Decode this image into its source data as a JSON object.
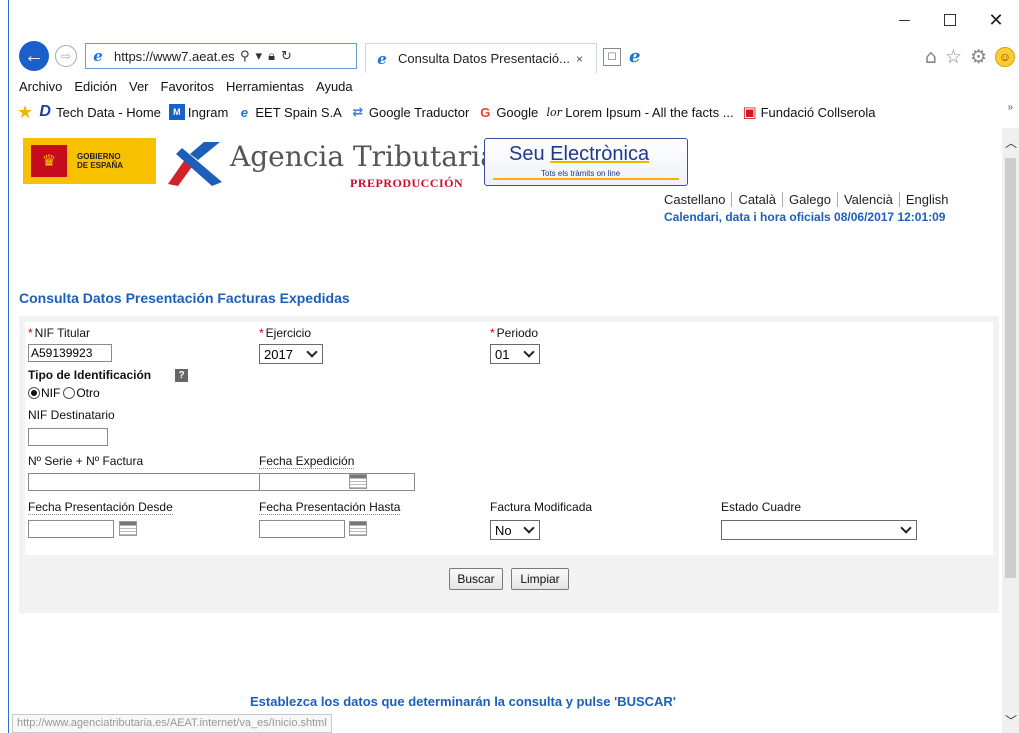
{
  "browser": {
    "url": "https://www7.aeat.es/",
    "tab_title": "Consulta Datos Presentació...",
    "tab_close": "×",
    "new_tab": "☐",
    "menu": [
      "Archivo",
      "Edición",
      "Ver",
      "Favoritos",
      "Herramientas",
      "Ayuda"
    ],
    "favorites": [
      {
        "label": "Tech Data - Home",
        "icon": "D",
        "color": "#1b3fa0"
      },
      {
        "label": "Ingram",
        "icon": "M",
        "color": "#ffffff"
      },
      {
        "label": "EET Spain S.A",
        "icon": "e",
        "color": "#1b73d9"
      },
      {
        "label": "Google Traductor",
        "icon": "↹",
        "color": "#3b7be0"
      },
      {
        "label": "Google",
        "icon": "G",
        "color": "#e8442e"
      },
      {
        "label": "Lorem Ipsum - All the facts ...",
        "icon": "lor",
        "color": "#333333"
      },
      {
        "label": "Fundació Collserola",
        "icon": "■",
        "color": "#d11a1a"
      }
    ],
    "fav_more": "»",
    "status_url": "http://www.agenciatributaria.es/AEAT.internet/va_es/Inicio.shtml"
  },
  "header": {
    "gobierno_line1": "GOBIERNO",
    "gobierno_line2": "DE ESPAÑA",
    "agency_name": "Agencia Tributaria",
    "environment": "PREPRODUCCIÓN",
    "seu_title_a": "Seu ",
    "seu_title_b": "Electrònica",
    "seu_sub": "Tots els tràmits on line",
    "languages": [
      "Castellano",
      "Català",
      "Galego",
      "Valencià",
      "English"
    ],
    "calendar": "Calendari, data i hora oficials 08/06/2017 12:01:09"
  },
  "form": {
    "title": "Consulta Datos Presentación Facturas Expedidas",
    "required_mark": "*",
    "nif_titular_label": "NIF Titular",
    "nif_titular_value": "A59139923",
    "ejercicio_label": "Ejercicio",
    "ejercicio_value": "2017",
    "periodo_label": "Periodo",
    "periodo_value": "01",
    "tipo_id_label": "Tipo de Identificación",
    "help": "?",
    "radio_nif": "NIF",
    "radio_otro": "Otro",
    "nif_dest_label": "NIF Destinatario",
    "serie_label": "Nº Serie + Nº Factura",
    "fecha_exp_label": "Fecha Expedición",
    "fecha_desde_label": "Fecha Presentación Desde",
    "fecha_hasta_label": "Fecha Presentación Hasta",
    "factura_mod_label": "Factura Modificada",
    "factura_mod_value": "No",
    "estado_label": "Estado Cuadre",
    "estado_value": "",
    "buscar": "Buscar",
    "limpiar": "Limpiar"
  },
  "instruction": "Establezca los datos que determinarán la consulta y pulse 'BUSCAR'",
  "colors": {
    "accent_blue": "#1d5fb8",
    "required_red": "#cc0000",
    "panel_gray": "#f2f2f2"
  }
}
